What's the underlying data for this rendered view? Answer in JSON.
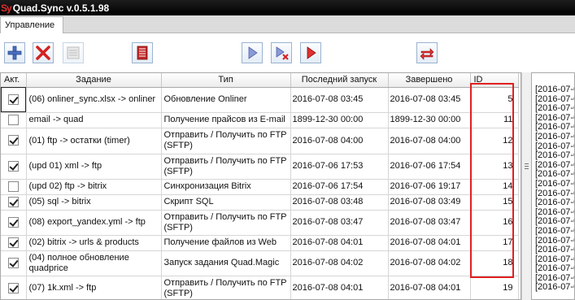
{
  "app": {
    "logo": "Sy",
    "title": "Quad.Sync v.0.5.1.98"
  },
  "tabs": [
    {
      "label": "Управление"
    }
  ],
  "toolbar": {
    "buttons": [
      "add",
      "delete",
      "disabled-card",
      "list",
      "play",
      "stop-run",
      "run",
      "sync"
    ]
  },
  "table": {
    "columns": [
      "Акт.",
      "Задание",
      "Тип",
      "Последний запуск",
      "Завершено",
      "ID"
    ],
    "rows": [
      {
        "active": true,
        "task": "(06) onliner_sync.xlsx -> onliner",
        "type": "Обновление Onliner",
        "last_run": "2016-07-08 03:45",
        "finished": "2016-07-08 03:45",
        "id": "5"
      },
      {
        "active": false,
        "task": "email -> quad",
        "type": "Получение прайсов из E-mail",
        "last_run": "1899-12-30 00:00",
        "finished": "1899-12-30 00:00",
        "id": "11"
      },
      {
        "active": true,
        "task": "(01) ftp -> остатки (timer)",
        "type": "Отправить / Получить по FTP (SFTP)",
        "last_run": "2016-07-08 04:00",
        "finished": "2016-07-08 04:00",
        "id": "12"
      },
      {
        "active": true,
        "task": "(upd 01) xml -> ftp",
        "type": "Отправить / Получить по FTP (SFTP)",
        "last_run": "2016-07-06 17:53",
        "finished": "2016-07-06 17:54",
        "id": "13"
      },
      {
        "active": false,
        "task": "(upd 02) ftp -> bitrix",
        "type": "Синхронизация Bitrix",
        "last_run": "2016-07-06 17:54",
        "finished": "2016-07-06 19:17",
        "id": "14"
      },
      {
        "active": true,
        "task": "(05) sql -> bitrix",
        "type": "Скрипт SQL",
        "last_run": "2016-07-08 03:48",
        "finished": "2016-07-08 03:49",
        "id": "15"
      },
      {
        "active": true,
        "task": "(08) export_yandex.yml -> ftp",
        "type": "Отправить / Получить по FTP (SFTP)",
        "last_run": "2016-07-08 03:47",
        "finished": "2016-07-08 03:47",
        "id": "16"
      },
      {
        "active": true,
        "task": "(02) bitrix -> urls & products",
        "type": "Получение файлов из Web",
        "last_run": "2016-07-08 04:01",
        "finished": "2016-07-08 04:01",
        "id": "17"
      },
      {
        "active": true,
        "task": "(04) полное обновление quadprice",
        "type": "Запуск задания Quad.Magic",
        "last_run": "2016-07-08 04:02",
        "finished": "2016-07-08 04:02",
        "id": "18"
      },
      {
        "active": true,
        "task": "(07) 1k.xml -> ftp",
        "type": "Отправить / Получить по FTP (SFTP)",
        "last_run": "2016-07-08 04:01",
        "finished": "2016-07-08 04:01",
        "id": "19"
      }
    ]
  },
  "log": {
    "lines": [
      "[2016-07-0",
      "[2016-07-0",
      "[2016-07-0",
      "[2016-07-0",
      "[2016-07-0",
      "[2016-07-0",
      "[2016-07-0",
      "[2016-07-0",
      "[2016-07-0",
      "[2016-07-0",
      "[2016-07-0",
      "[2016-07-0",
      "[2016-07-0",
      "[2016-07-0",
      "[2016-07-0",
      "[2016-07-0",
      "[2016-07-0",
      "[2016-07-0",
      "[2016-07-0",
      "[2016-07-0",
      "[2016-07-0",
      "[2016-07-0"
    ]
  },
  "colors": {
    "highlight": "#e02020",
    "titlebar": "#000000",
    "accent_red": "#d42020",
    "accent_blue": "#4a6fc0"
  }
}
